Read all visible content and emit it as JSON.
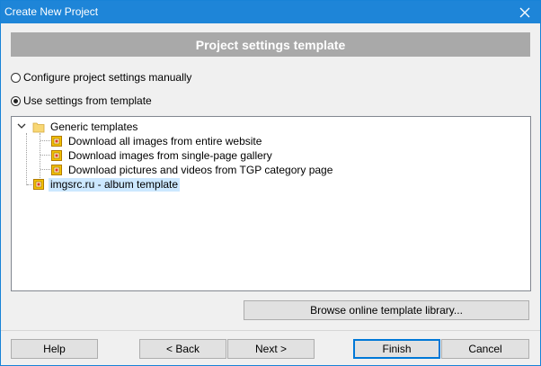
{
  "window": {
    "title": "Create New Project",
    "close_label": "✕"
  },
  "banner": {
    "text": "Project settings template"
  },
  "options": {
    "manual_label": "Configure project settings manually",
    "template_label": "Use settings from template",
    "selected": "template"
  },
  "tree": {
    "folder": {
      "label": "Generic templates",
      "expanded": true,
      "children": [
        {
          "label": "Download all images from entire website"
        },
        {
          "label": "Download images from single-page gallery"
        },
        {
          "label": "Download pictures and videos from TGP category page"
        }
      ]
    },
    "root_item": {
      "label": "imgsrc.ru - album template",
      "selected": true
    }
  },
  "buttons": {
    "browse": "Browse online template library...",
    "help": "Help",
    "back": "< Back",
    "next": "Next >",
    "finish": "Finish",
    "cancel": "Cancel"
  },
  "colors": {
    "titlebar": "#1e85d8",
    "banner": "#a9a9a9",
    "selection": "#cce8ff",
    "default_button_border": "#0078d7"
  },
  "icons": {
    "close": "close-icon",
    "expander": "chevron-down-icon",
    "folder": "folder-icon",
    "template": "template-icon"
  }
}
